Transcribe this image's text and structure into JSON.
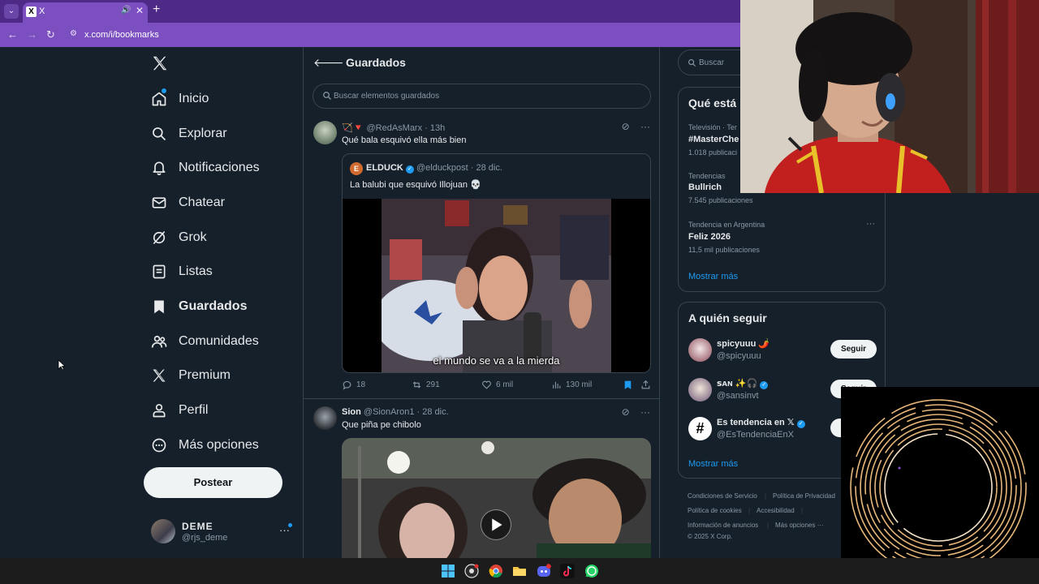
{
  "browser": {
    "tab_title": "X",
    "tab_favicon": "X",
    "url": "x.com/i/bookmarks"
  },
  "nav": {
    "items": [
      {
        "label": "Inicio",
        "icon": "home-icon"
      },
      {
        "label": "Explorar",
        "icon": "search-icon"
      },
      {
        "label": "Notificaciones",
        "icon": "bell-icon"
      },
      {
        "label": "Chatear",
        "icon": "mail-icon"
      },
      {
        "label": "Grok",
        "icon": "grok-icon"
      },
      {
        "label": "Listas",
        "icon": "list-icon"
      },
      {
        "label": "Guardados",
        "icon": "bookmark-icon"
      },
      {
        "label": "Comunidades",
        "icon": "people-icon"
      },
      {
        "label": "Premium",
        "icon": "x-icon"
      },
      {
        "label": "Perfil",
        "icon": "user-icon"
      },
      {
        "label": "Más opciones",
        "icon": "more-circle-icon"
      }
    ],
    "post_button": "Postear",
    "profile": {
      "name": "DEME",
      "handle": "@rjs_deme",
      "more": "···"
    }
  },
  "main": {
    "title": "Guardados",
    "search_placeholder": "Buscar elementos guardados",
    "tweets": [
      {
        "name": "🏹🔻",
        "meta": "@RedAsMarx · 13h",
        "text": "Qué bala esquivó ella más bien",
        "quote": {
          "avatar_letter": "E",
          "name": "ELDUCK",
          "verified": "✓",
          "meta": "@elduckpost · 28 dic.",
          "text": "La balubi que esquivó Illojuan 💀",
          "caption": "el mundo se va a la mierda"
        },
        "actions": {
          "replies": "18",
          "reposts": "291",
          "likes": "6 mil",
          "views": "130 mil"
        }
      },
      {
        "name": "Sion",
        "meta": "@SionAron1 · 28 dic.",
        "text": "Que piña pe chibolo"
      }
    ]
  },
  "right": {
    "search_placeholder": "Buscar",
    "trends_title": "Qué está",
    "trends": [
      {
        "category": "Televisión · Ter",
        "name": "#MasterChe",
        "count": "1.018 publicaci"
      },
      {
        "category": "Tendencias",
        "name": "Bullrich",
        "count": "7.545 publicaciones"
      },
      {
        "category": "Tendencia en Argentina",
        "name": "Feliz 2026",
        "count": "11,5 mil publicaciones",
        "more": "···"
      }
    ],
    "trends_show_more": "Mostrar más",
    "follow_title": "A quién seguir",
    "follow": [
      {
        "name": "spicyuuu 🌶️",
        "handle": "@spicyuuu",
        "button": "Seguir"
      },
      {
        "name": "ꜱᴀɴ ✨🎧",
        "verified": "✓",
        "handle": "@sansinvt",
        "button": "Seguir"
      },
      {
        "name": "Es tendencia en 𝕏",
        "verified": "✓",
        "handle": "@EsTendenciaEnX",
        "avatar_text": "#",
        "button": "Seguir"
      }
    ],
    "follow_show_more": "Mostrar más",
    "footer": [
      "Condiciones de Servicio",
      "Política de Privacidad",
      "Política de cookies",
      "Accesibilidad",
      "Información de anuncios",
      "Más opciones ···",
      "© 2025 X Corp."
    ]
  },
  "colors": {
    "background": "#15202b",
    "border": "#38444d",
    "accent": "#1d9bf0",
    "browser_chrome": "#7b4fc0"
  }
}
